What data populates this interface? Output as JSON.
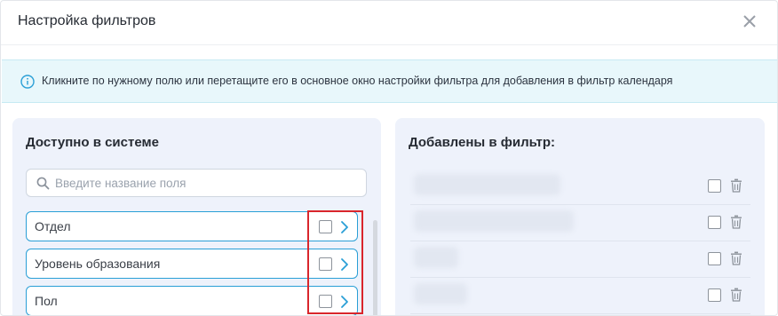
{
  "dialog": {
    "title": "Настройка фильтров",
    "info_text": "Кликните по нужному полю или перетащите его в основное окно настройки фильтра для добавления в фильтр календаря"
  },
  "available": {
    "title": "Доступно в системе",
    "search_placeholder": "Введите название поля",
    "fields": [
      {
        "label": "Отдел"
      },
      {
        "label": "Уровень образования"
      },
      {
        "label": "Пол"
      }
    ]
  },
  "added": {
    "title": "Добавлены в фильтр:"
  },
  "colors": {
    "accent": "#2a9fd6",
    "highlight": "#d9262c",
    "panel_bg": "#eef2fb",
    "info_bg": "#e8f7fb"
  }
}
